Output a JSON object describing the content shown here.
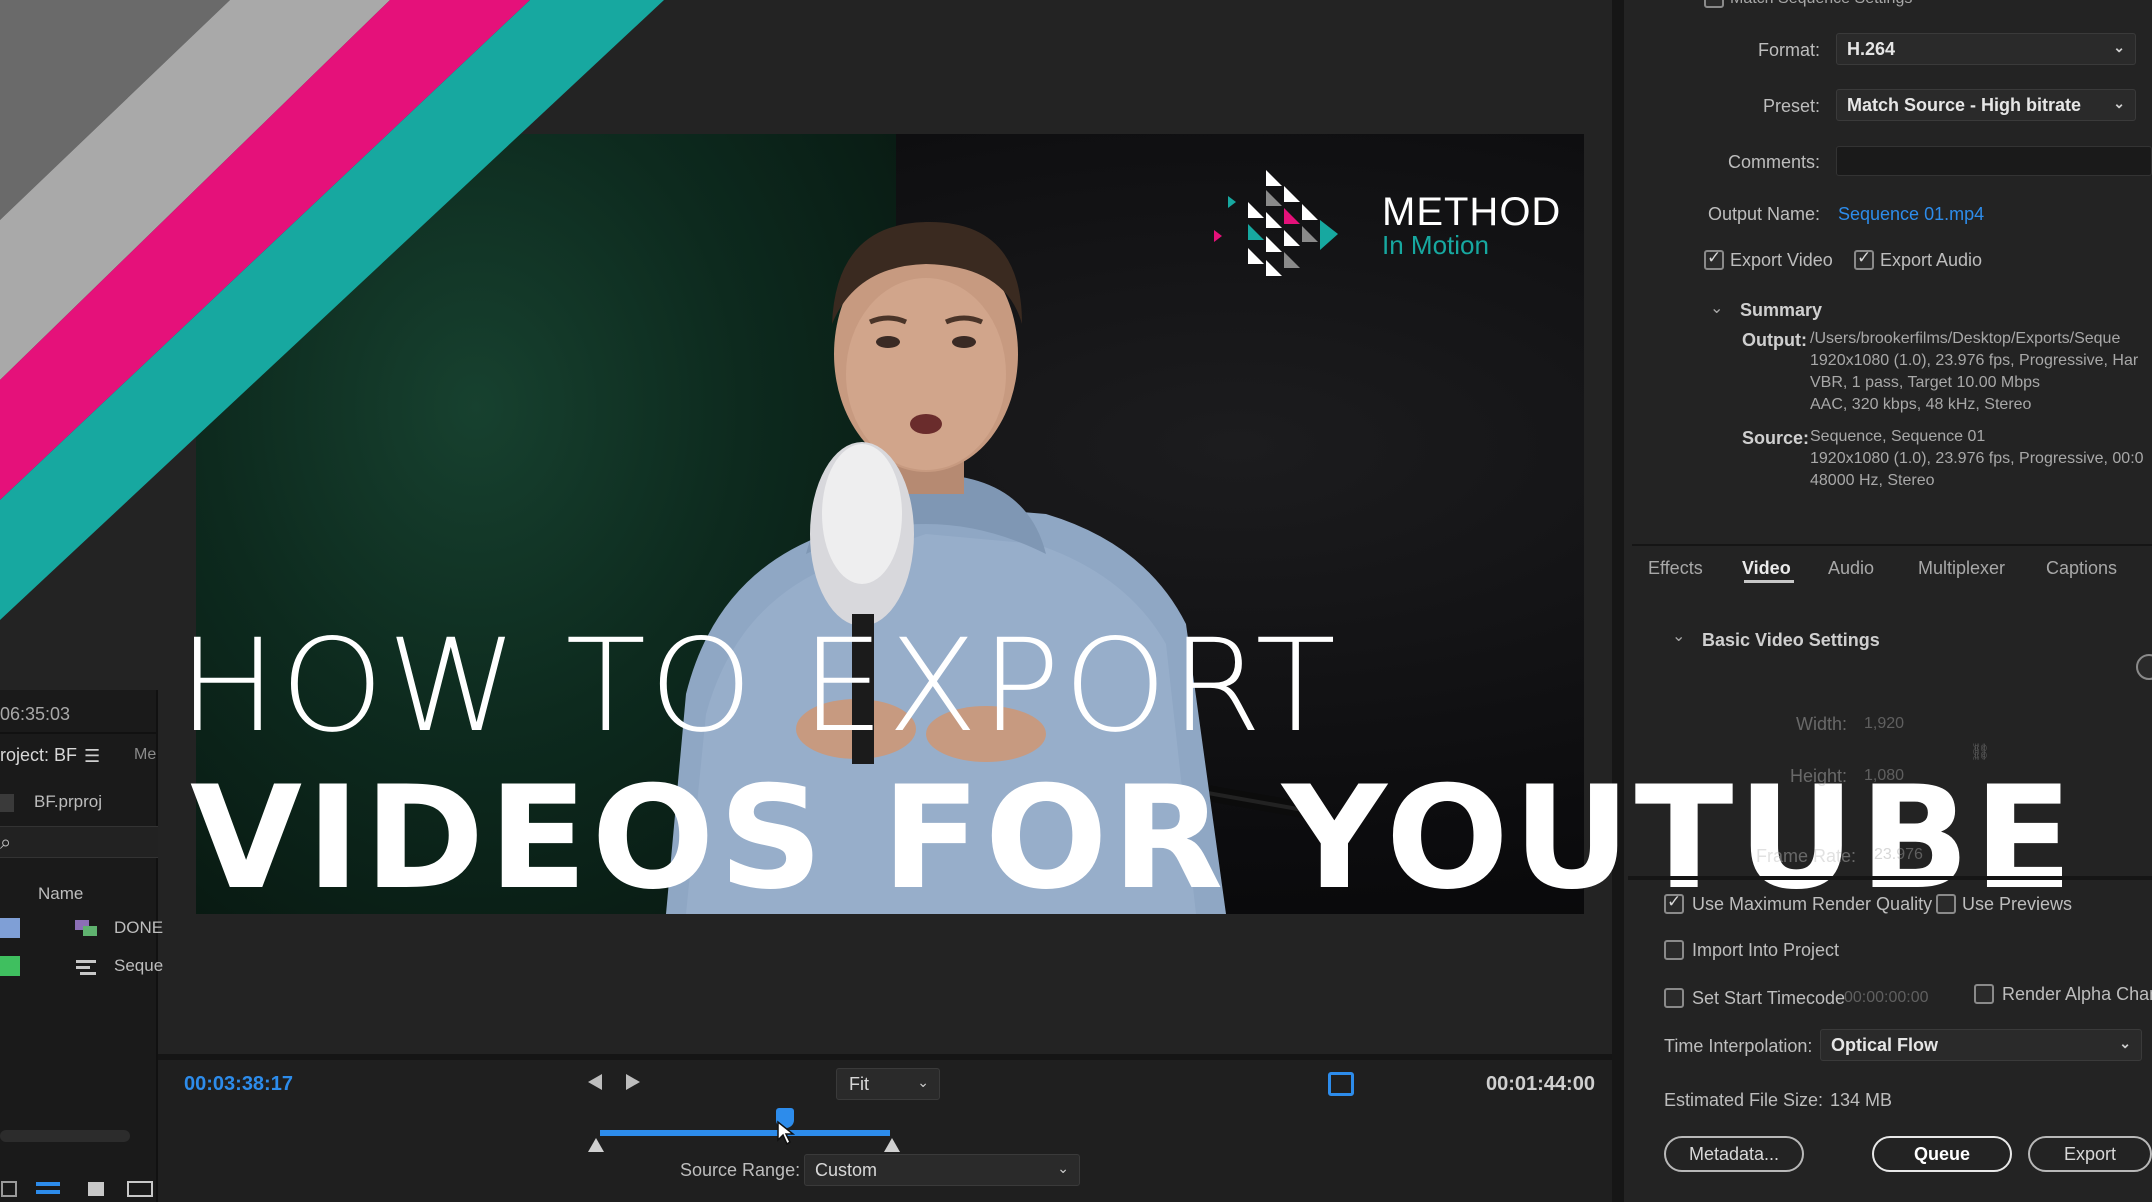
{
  "headline": {
    "line1": "HOW TO EXPORT",
    "line2": "VIDEOS FOR YOUTUBE"
  },
  "logo": {
    "name": "METHOD",
    "tagline": "In Motion",
    "accent_teal": "#17a8a0",
    "accent_pink": "#e5117a"
  },
  "stripes": {
    "colors": [
      "#6a6a6a",
      "#a9a9a9",
      "#e5117a",
      "#17a8a0"
    ]
  },
  "sidebar": {
    "timecode": "06:35:03",
    "project_label": "roject: BF",
    "menu_icon": "hamburger-icon",
    "tab_partial": "Me",
    "project_file": "BF.prproj",
    "column_name": "Name",
    "items": [
      {
        "label": "DONE",
        "swatch": "#7f9fd6",
        "icon": "multicam-sequence-icon"
      },
      {
        "label": "Seque",
        "swatch": "#3fbf5f",
        "icon": "sequence-icon"
      }
    ]
  },
  "playback": {
    "in_timecode": "00:03:38:17",
    "out_timecode": "00:01:44:00",
    "fit_value": "Fit",
    "source_range_label": "Source Range:",
    "source_range_value": "Custom",
    "playhead_position": 0.47
  },
  "export": {
    "match_sequence_label": "Match Sequence Settings",
    "format_label": "Format:",
    "format_value": "H.264",
    "preset_label": "Preset:",
    "preset_value": "Match Source - High bitrate",
    "comments_label": "Comments:",
    "output_name_label": "Output Name:",
    "output_name_value": "Sequence 01.mp4",
    "export_video_label": "Export Video",
    "export_audio_label": "Export Audio",
    "summary_label": "Summary",
    "output_label": "Output:",
    "output_lines": [
      "/Users/brookerfilms/Desktop/Exports/Seque",
      "1920x1080 (1.0), 23.976 fps, Progressive, Har",
      "VBR, 1 pass, Target 10.00 Mbps",
      "AAC, 320 kbps, 48 kHz, Stereo"
    ],
    "source_label": "Source:",
    "source_lines": [
      "Sequence, Sequence 01",
      "1920x1080 (1.0), 23.976 fps, Progressive, 00:0",
      "48000 Hz, Stereo"
    ],
    "tabs": [
      "Effects",
      "Video",
      "Audio",
      "Multiplexer",
      "Captions"
    ],
    "active_tab": "Video",
    "basic_video_label": "Basic Video Settings",
    "width_label": "Width:",
    "width_value": "1,920",
    "height_label": "Height:",
    "height_value": "1,080",
    "frame_rate_label": "Frame Rate:",
    "frame_rate_value": "23.976",
    "use_max_render_label": "Use Maximum Render Quality",
    "use_previews_label": "Use Previews",
    "import_into_project_label": "Import Into Project",
    "set_start_timecode_label": "Set Start Timecode",
    "start_timecode_value": "00:00:00:00",
    "render_alpha_label": "Render Alpha Chann",
    "time_interp_label": "Time Interpolation:",
    "time_interp_value": "Optical Flow",
    "est_size_label": "Estimated File Size:",
    "est_size_value": "134 MB",
    "metadata_button": "Metadata...",
    "queue_button": "Queue",
    "export_button": "Export"
  }
}
